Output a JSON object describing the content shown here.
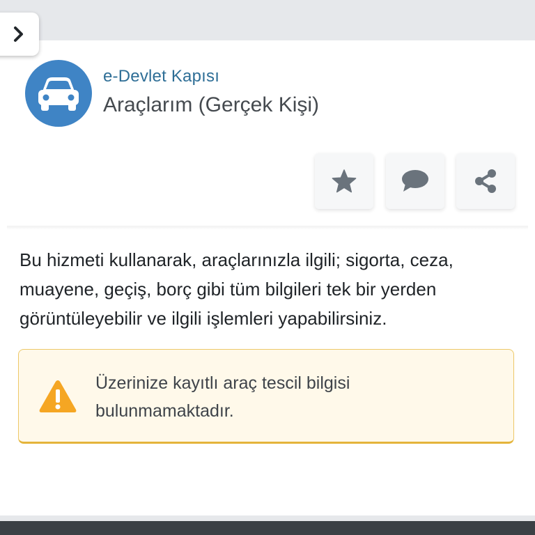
{
  "header": {
    "portal_name": "e-Devlet Kapısı",
    "service_title": "Araçlarım (Gerçek Kişi)"
  },
  "icons": {
    "toggle": "chevron-right-icon",
    "service": "car-icon",
    "favorite": "star-icon",
    "comment": "speech-bubble-icon",
    "share": "share-icon",
    "alert": "warning-triangle-icon"
  },
  "content": {
    "description": "Bu hizmeti kullanarak, araçlarınızla ilgili; sigorta, ceza, muayene, geçiş, borç gibi tüm bilgileri tek bir yerden görüntüleyebilir ve ilgili işlemleri yapabilirsiniz."
  },
  "alert": {
    "message": "Üzerinize kayıtlı araç tescil bilgisi bulunmamaktadır."
  },
  "colors": {
    "brand_blue": "#3f84c5",
    "portal_text": "#2e6e96",
    "alert_background": "#fff9ea",
    "alert_border": "#e4b43a",
    "warning_orange": "#f5a623",
    "button_icon": "#6a737c"
  }
}
